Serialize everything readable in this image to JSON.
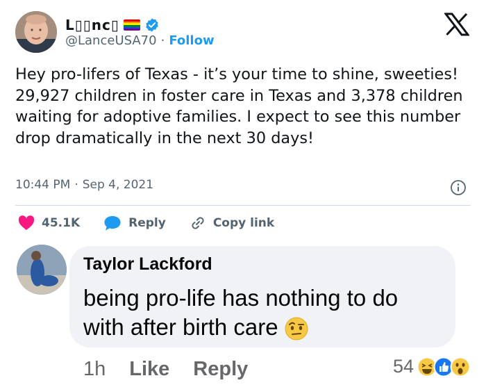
{
  "tweet": {
    "display_name": "L▯▯nc▯",
    "handle": "@LanceUSA70",
    "separator": "·",
    "follow_label": "Follow",
    "text": "Hey pro-lifers of Texas - it’s your time to shine, sweeties! 29,927 children in foster care in Texas and 3,378 children waiting for adoptive families. I expect to see this number drop dramatically in the next 30 days!",
    "time": "10:44 PM",
    "date": "Sep 4, 2021",
    "likes": "45.1K",
    "reply_label": "Reply",
    "copy_link_label": "Copy link",
    "icons": [
      "x-logo-icon",
      "verified-badge-icon",
      "pride-flag-icon",
      "info-icon",
      "heart-icon",
      "reply-bubble-icon",
      "link-icon"
    ],
    "colors": {
      "accent": "#1d9bf0",
      "heart": "#f91880",
      "muted": "#536471"
    }
  },
  "comment": {
    "author": "Taylor Lackford",
    "text": "being pro-life has nothing to do with after birth care",
    "time": "1h",
    "like_label": "Like",
    "reply_label": "Reply",
    "reaction_count": "54",
    "reactions": [
      "laughing-emoji-icon",
      "like-thumb-icon",
      "wow-emoji-icon"
    ],
    "inline_emoji": "raised-eyebrow-emoji-icon"
  }
}
